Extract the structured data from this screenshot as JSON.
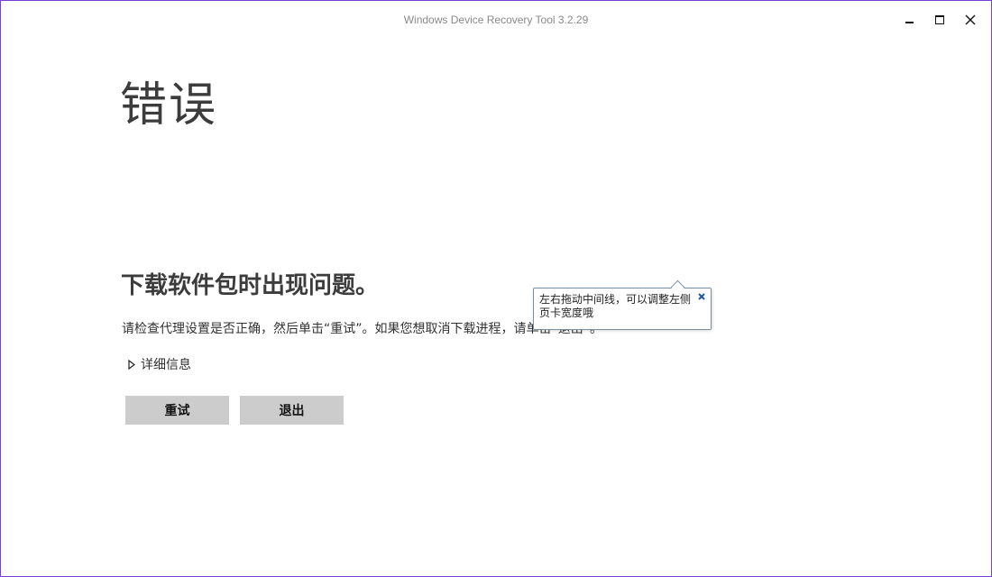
{
  "window": {
    "title": "Windows Device Recovery Tool 3.2.29",
    "border_color": "#7a3fd6"
  },
  "titlebar": {
    "minimize_icon": "minimize-icon",
    "maximize_icon": "maximize-icon",
    "close_icon": "close-icon"
  },
  "main": {
    "heading": "错误",
    "subheading": "下载软件包时出现问题。",
    "message": "请检查代理设置是否正确，然后单击“重试”。如果您想取消下载进程，请单击“退出”。",
    "details_label": "详细信息",
    "details_icon": "triangle-right-icon",
    "buttons": {
      "retry": "重试",
      "exit": "退出"
    },
    "button_color": "#cccccc"
  },
  "tooltip": {
    "text": "左右拖动中间线，可以调整左侧页卡宽度哦",
    "close_icon": "close-icon",
    "accent": "#1e5aa8"
  }
}
